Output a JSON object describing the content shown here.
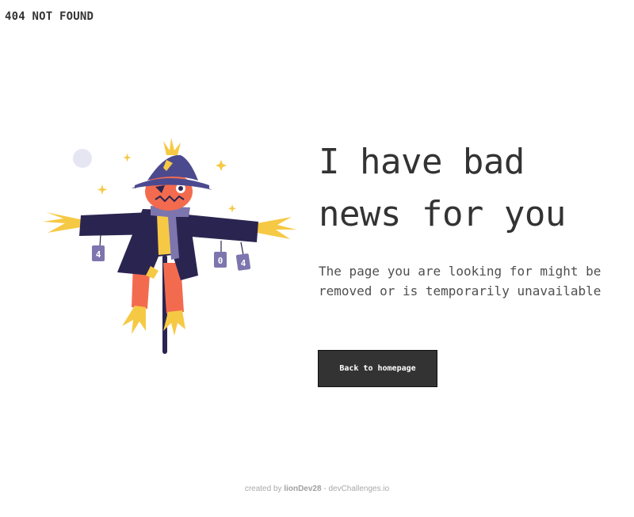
{
  "brand": {
    "label": "404 NOT FOUND"
  },
  "main": {
    "headline_line1": "I have bad",
    "headline_line2": "news for you",
    "subtitle": "The page you are looking for might be removed or is temporarily unavailable",
    "cta_label": "Back to homepage"
  },
  "illustration": {
    "can_labels": [
      "4",
      "0",
      "4"
    ]
  },
  "footer": {
    "prefix": "created by ",
    "author": "lionDev28",
    "suffix": " - devChallenges.io"
  },
  "colors": {
    "text": "#333333",
    "button_bg": "#333333",
    "button_text": "#ffffff",
    "hat": "#4c4a8f",
    "coat": "#2a2550",
    "pumpkin": "#f36b4f",
    "straw": "#f6c945",
    "can": "#7d75ae",
    "moon": "#e6e6f3"
  }
}
